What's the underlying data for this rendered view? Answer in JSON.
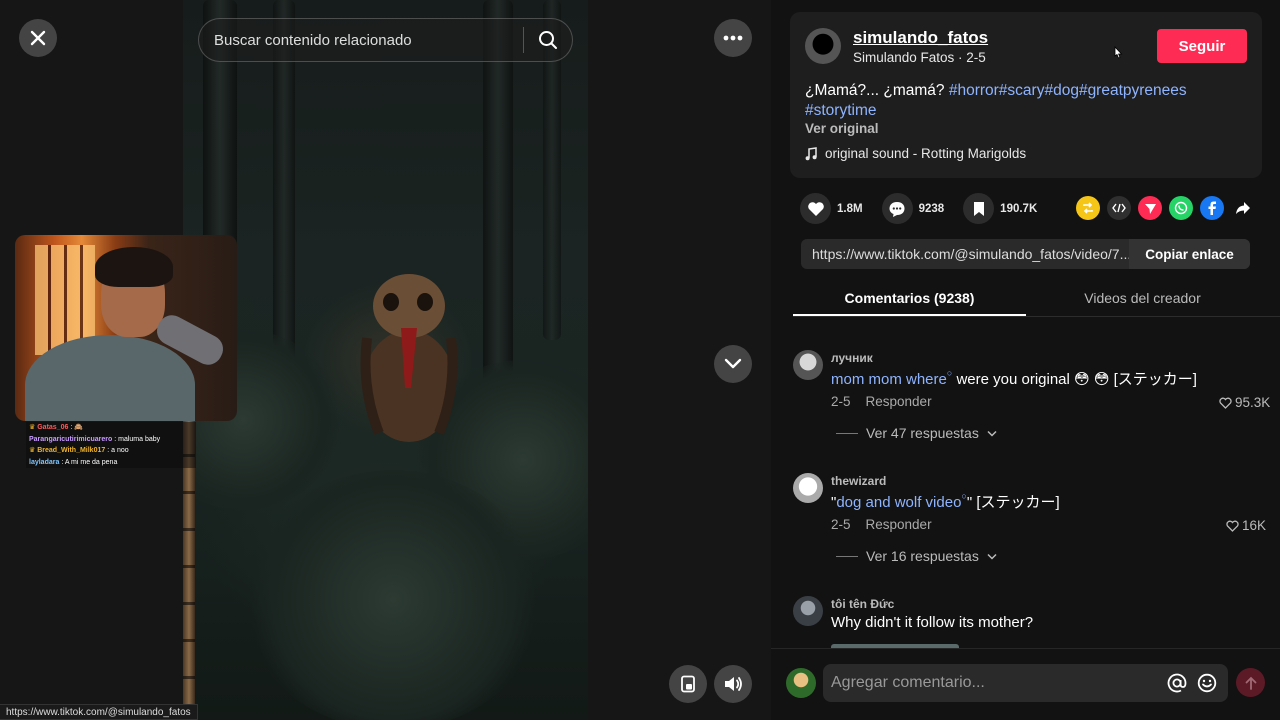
{
  "video": {
    "search_placeholder": "Buscar contenido relacionado",
    "status_url": "https://www.tiktok.com/@simulando_fatos"
  },
  "chat": [
    {
      "user": "Gatas_06",
      "text": "🙈",
      "color": "#ff5a5a",
      "badge": "crown-icon"
    },
    {
      "user": "Parangaricutirimicuarero",
      "text": ": maluma baby",
      "color": "#c89cff"
    },
    {
      "user": "Bread_With_Milk017",
      "text": ": a noo",
      "color": "#f0b42a",
      "badge": "crown-icon"
    },
    {
      "user": "layladara",
      "text": ": A mi me da pena",
      "color": "#7fc7ff"
    }
  ],
  "author": {
    "name": "simulando_fatos",
    "subtitle": "Simulando Fatos · 2-5",
    "follow_label": "Seguir"
  },
  "post": {
    "caption": "¿Mamá?... ¿mamá?",
    "hashtags": "#horror#scary#dog#greatpyrenees #storytime",
    "view_original": "Ver original",
    "sound": "original sound - Rotting Marigolds"
  },
  "stats": {
    "likes": "1.8M",
    "comments": "9238",
    "saves": "190.7K"
  },
  "share_icons": [
    "repost-icon",
    "embed-icon",
    "send-to-friends-icon",
    "whatsapp-icon",
    "facebook-icon",
    "share-arrow-icon"
  ],
  "link": {
    "url": "https://www.tiktok.com/@simulando_fatos/video/7...",
    "copy_label": "Copiar enlace"
  },
  "tabs": {
    "comments": "Comentarios (9238)",
    "creator": "Videos del creador"
  },
  "comments": [
    {
      "user": "лучник",
      "link_text": "mom mom where",
      "text": " were you original 😳 😳 [ステッカー]",
      "date": "2-5",
      "reply": "Responder",
      "likes": "95.3K",
      "more": "Ver 47 respuestas"
    },
    {
      "user": "thewizard",
      "prefix": "\"",
      "link_text": "dog and wolf video",
      "text": "\" [ステッカー]",
      "date": "2-5",
      "reply": "Responder",
      "likes": "16K",
      "more": "Ver 16 respuestas"
    },
    {
      "user": "tôi tên Đức",
      "text": "Why didn't it follow its mother?"
    }
  ],
  "composer": {
    "placeholder": "Agregar comentario..."
  },
  "colors": {
    "accent": "#fe2c55",
    "hashtag": "#8fb4ff",
    "panel_bg": "#121212"
  }
}
